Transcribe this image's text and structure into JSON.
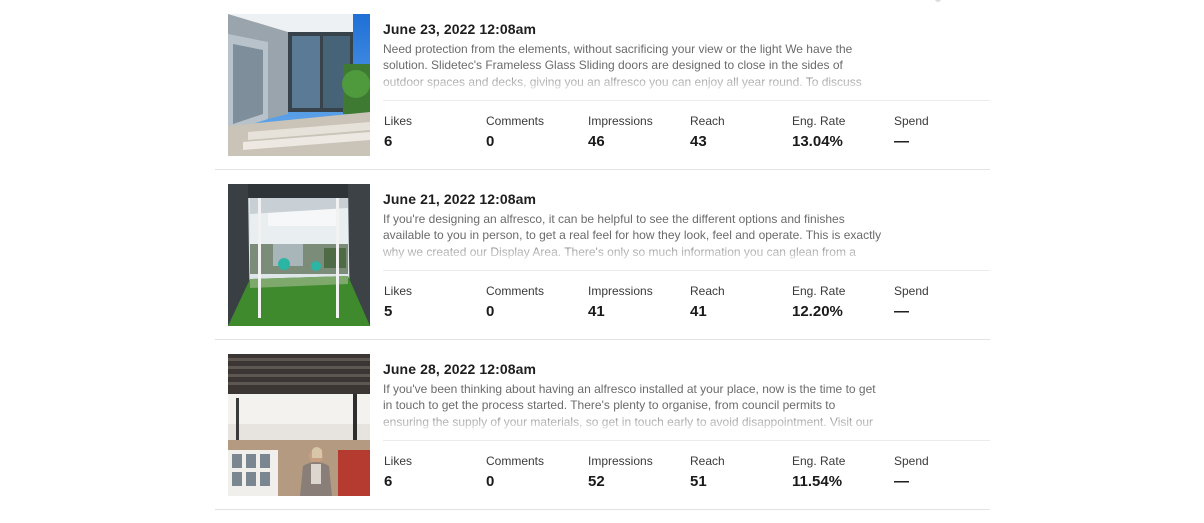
{
  "metric_labels": {
    "likes": "Likes",
    "comments": "Comments",
    "impressions": "Impressions",
    "reach": "Reach",
    "eng_rate": "Eng. Rate",
    "spend": "Spend"
  },
  "posts": [
    {
      "date": "June 23, 2022 12:08am",
      "caption": "Need protection from the elements, without sacrificing your view or the light We have the solution. Slidetec's Frameless Glass Sliding doors are designed to close in the sides of outdoor spaces and decks, giving you an alfresco you can enjoy all year round. To discuss adding an",
      "image": "glass-sliding-doors-photo",
      "likes": "6",
      "comments": "0",
      "impressions": "46",
      "reach": "43",
      "eng_rate": "13.04%",
      "spend": "—"
    },
    {
      "date": "June 21, 2022 12:08am",
      "caption": "If you're designing an alfresco, it can be helpful to see the different options and finishes available to you in person, to get a real feel for how they look, feel and operate. This is exactly why we created our Display Area. There's only so much information you can glean from a catalogue",
      "image": "display-area-alfresco-photo",
      "likes": "5",
      "comments": "0",
      "impressions": "41",
      "reach": "41",
      "eng_rate": "12.20%",
      "spend": "—"
    },
    {
      "date": "June 28, 2022 12:08am",
      "caption": "If you've been thinking about having an alfresco installed at your place, now is the time to get in touch to get the process started. There's plenty to organise, from council permits to ensuring the supply of your materials, so get in touch early to avoid disappointment. Visit our",
      "image": "louvre-roof-presenter-photo",
      "likes": "6",
      "comments": "0",
      "impressions": "52",
      "reach": "51",
      "eng_rate": "11.54%",
      "spend": "—"
    }
  ]
}
